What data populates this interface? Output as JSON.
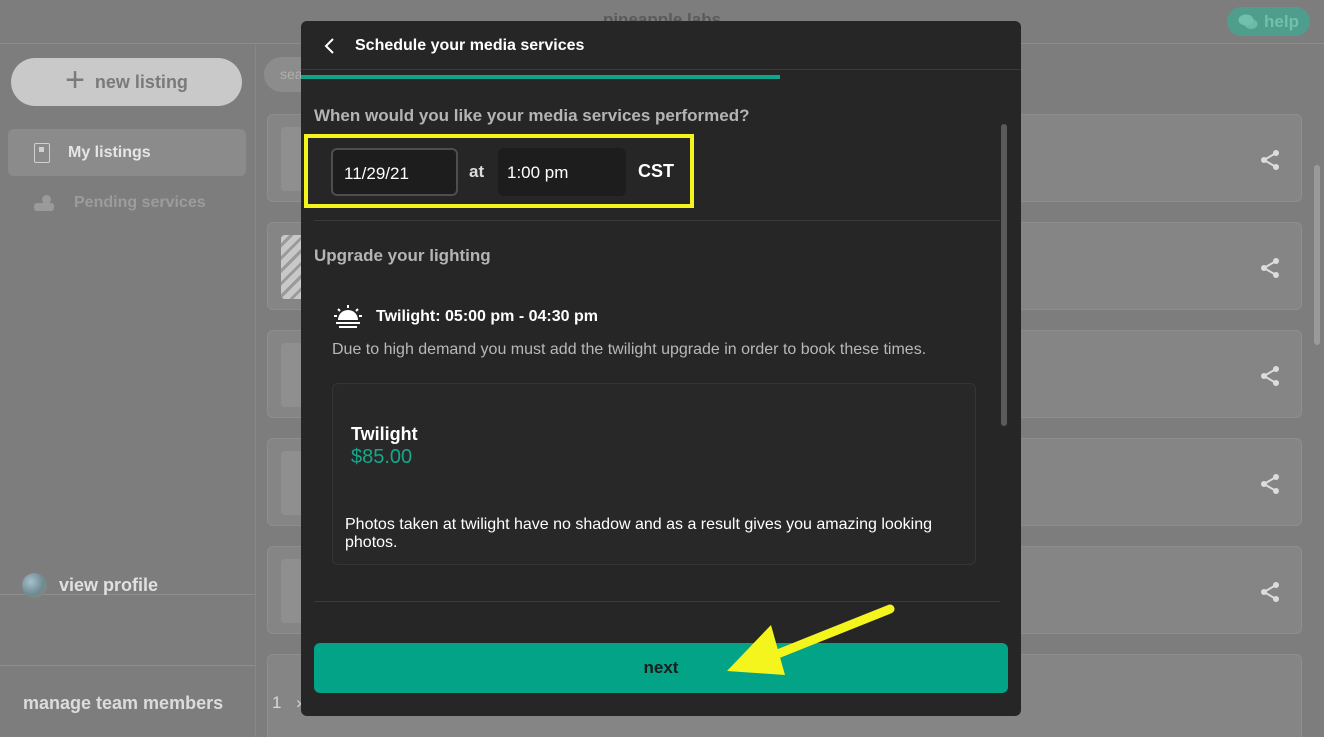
{
  "app": {
    "brand": "pineapple labs",
    "help_label": "help"
  },
  "sidebar": {
    "new_listing_label": "new listing",
    "items": [
      {
        "label": "My listings",
        "active": true
      },
      {
        "label": "Pending services",
        "active": false
      }
    ],
    "view_profile_label": "view profile",
    "manage_team_label": "manage team members"
  },
  "main": {
    "search_placeholder": "sea",
    "page_number": "1",
    "pager_chevron": "›"
  },
  "modal": {
    "title": "Schedule your media services",
    "question": "When would you like your media services performed?",
    "date_value": "11/29/21",
    "at_label": "at",
    "time_value": "1:00 pm",
    "timezone": "CST",
    "lighting_section_title": "Upgrade your lighting",
    "twilight_time_label": "Twilight: 05:00 pm - 04:30 pm",
    "demand_note": "Due to high demand you must add the twilight upgrade in order to book these times.",
    "upgrade": {
      "name": "Twilight",
      "price": "$85.00",
      "description": "Photos taken at twilight have no shadow and as a result gives you amazing looking photos."
    },
    "next_label": "next"
  },
  "colors": {
    "accent": "#02a386",
    "highlight": "#f4f51c",
    "modal_bg": "#262626"
  }
}
